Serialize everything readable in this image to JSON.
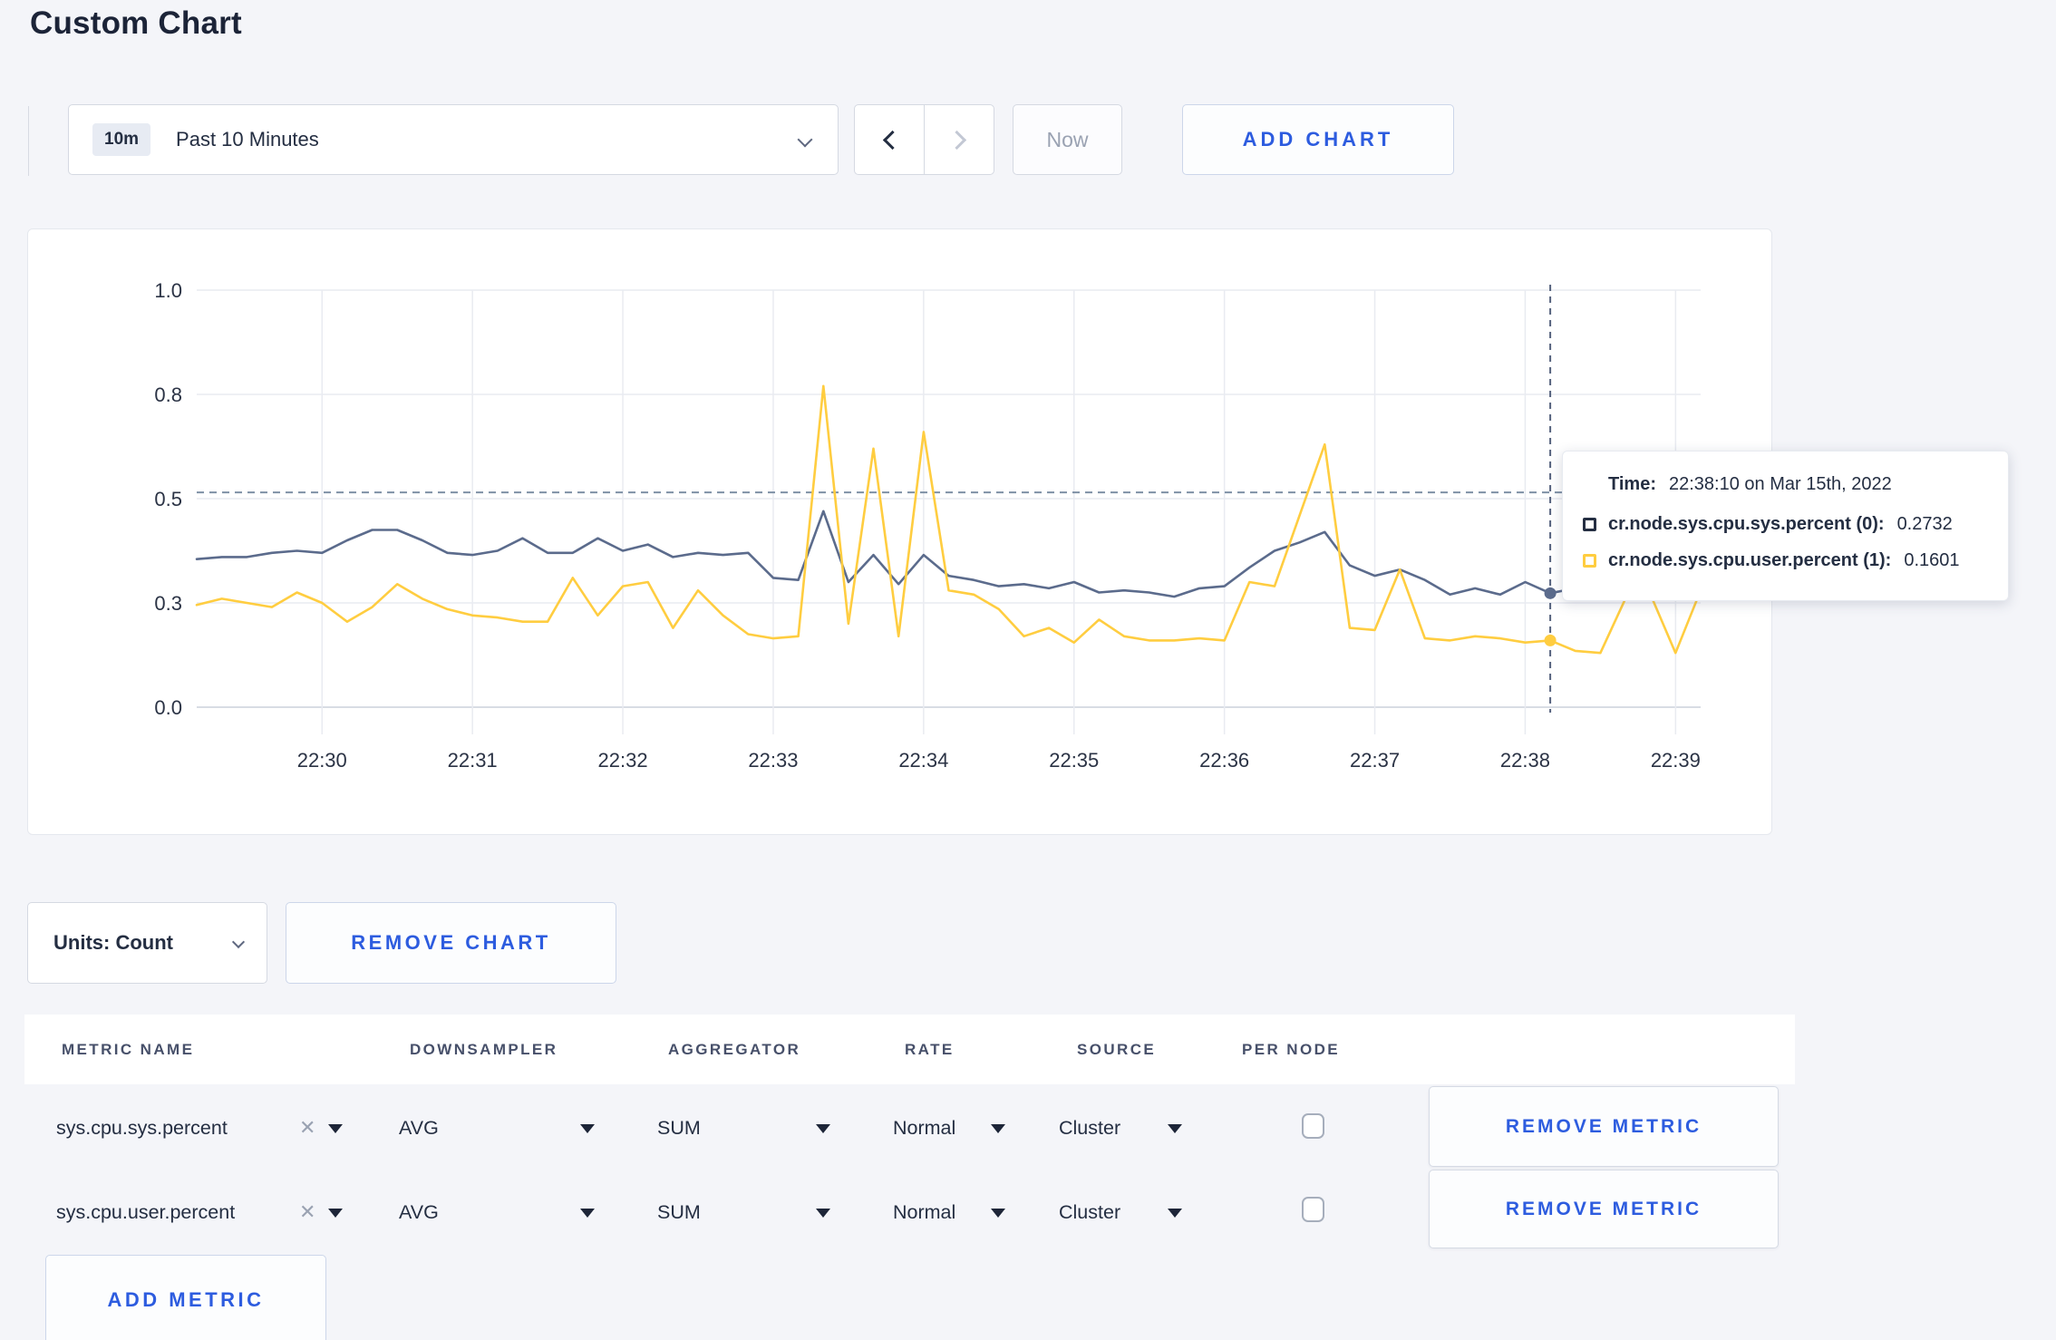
{
  "title": "Custom Chart",
  "toolbar": {
    "time_badge": "10m",
    "time_selected": "Past 10 Minutes",
    "now_label": "Now",
    "add_chart_label": "ADD CHART"
  },
  "chart_controls": {
    "units_label": "Units: Count",
    "remove_chart_label": "REMOVE CHART"
  },
  "chart_data": {
    "type": "line",
    "title": "",
    "xlabel": "",
    "ylabel": "",
    "x_start": "22:29:10",
    "x_end": "22:39:10",
    "interval_seconds": 10,
    "x_tick_labels": [
      "22:30",
      "22:31",
      "22:32",
      "22:33",
      "22:34",
      "22:35",
      "22:36",
      "22:37",
      "22:38",
      "22:39"
    ],
    "y_ticks": [
      {
        "value": 1.0,
        "label": "1.0"
      },
      {
        "value": 0.75,
        "label": "0.8"
      },
      {
        "value": 0.5,
        "label": "0.5"
      },
      {
        "value": 0.25,
        "label": "0.3"
      },
      {
        "value": 0.0,
        "label": "0.0"
      }
    ],
    "ylim": [
      0,
      1
    ],
    "grid": true,
    "threshold_line_value": 0.515,
    "crosshair_index": 54,
    "crosshair_time": "22:38:10",
    "series": [
      {
        "name": "cr.node.sys.cpu.sys.percent (0)",
        "color": "#5b6b8c",
        "values": [
          0.355,
          0.36,
          0.36,
          0.37,
          0.375,
          0.37,
          0.4,
          0.425,
          0.425,
          0.4,
          0.37,
          0.365,
          0.375,
          0.405,
          0.37,
          0.37,
          0.405,
          0.375,
          0.39,
          0.36,
          0.37,
          0.365,
          0.37,
          0.31,
          0.305,
          0.47,
          0.3,
          0.365,
          0.295,
          0.365,
          0.315,
          0.305,
          0.29,
          0.295,
          0.285,
          0.3,
          0.275,
          0.28,
          0.275,
          0.265,
          0.285,
          0.29,
          0.335,
          0.375,
          0.395,
          0.42,
          0.34,
          0.315,
          0.33,
          0.305,
          0.27,
          0.285,
          0.27,
          0.3,
          0.2732,
          0.285,
          0.3,
          0.32,
          0.305,
          0.3,
          0.315
        ]
      },
      {
        "name": "cr.node.sys.cpu.user.percent (1)",
        "color": "#ffcd40",
        "values": [
          0.245,
          0.26,
          0.25,
          0.24,
          0.275,
          0.25,
          0.205,
          0.24,
          0.295,
          0.26,
          0.235,
          0.22,
          0.215,
          0.205,
          0.205,
          0.31,
          0.22,
          0.29,
          0.3,
          0.19,
          0.28,
          0.22,
          0.175,
          0.165,
          0.17,
          0.77,
          0.2,
          0.62,
          0.17,
          0.66,
          0.28,
          0.27,
          0.235,
          0.17,
          0.19,
          0.155,
          0.21,
          0.17,
          0.16,
          0.16,
          0.165,
          0.16,
          0.3,
          0.29,
          0.46,
          0.63,
          0.19,
          0.185,
          0.33,
          0.165,
          0.16,
          0.17,
          0.165,
          0.155,
          0.1601,
          0.135,
          0.13,
          0.26,
          0.27,
          0.13,
          0.28
        ]
      }
    ]
  },
  "tooltip": {
    "time_label": "Time:",
    "time_value": "22:38:10 on Mar 15th, 2022",
    "rows": [
      {
        "name": "cr.node.sys.cpu.sys.percent (0):",
        "value": "0.2732",
        "color": "#242e42"
      },
      {
        "name": "cr.node.sys.cpu.user.percent (1):",
        "value": "0.1601",
        "color": "#ffcd40"
      }
    ]
  },
  "metrics_table": {
    "headers": [
      "METRIC NAME",
      "DOWNSAMPLER",
      "AGGREGATOR",
      "RATE",
      "SOURCE",
      "PER NODE"
    ],
    "remove_metric_label": "REMOVE METRIC",
    "add_metric_label": "ADD METRIC",
    "clear_glyph": "✕",
    "rows": [
      {
        "metric": "sys.cpu.sys.percent",
        "downsampler": "AVG",
        "aggregator": "SUM",
        "rate": "Normal",
        "source": "Cluster",
        "per_node": false
      },
      {
        "metric": "sys.cpu.user.percent",
        "downsampler": "AVG",
        "aggregator": "SUM",
        "rate": "Normal",
        "source": "Cluster",
        "per_node": false
      }
    ]
  }
}
